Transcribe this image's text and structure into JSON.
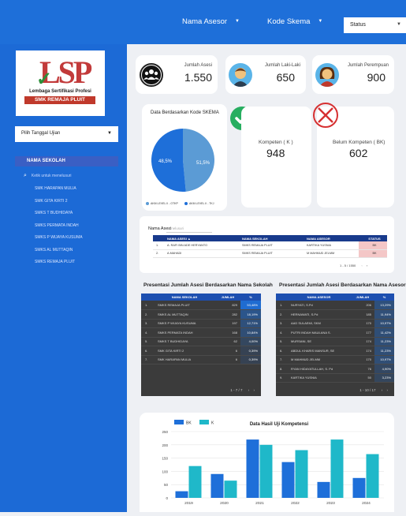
{
  "topbar": {
    "filter_asesor": "Nama Asesor",
    "filter_skema": "Kode Skema",
    "status_label": "Status"
  },
  "sidebar": {
    "logo_letters": "LSP",
    "logo_sub": "Lembaga Sertifikasi Profesi",
    "logo_band": "SMK REMAJA PLUIT",
    "date_placeholder": "Pilih Tanggal Ujian",
    "school_header": "NAMA SEKOLAH",
    "search_placeholder": "Ketik untuk menelusuri",
    "schools": [
      "SMK HARAPAN MULIA",
      "SMK GITA KIRTI 2",
      "SMKS T BUDHIDAYA",
      "SMKS PERMATA INDAH",
      "SMKS P WIJAYA KUSUMA",
      "SMKS AL MUTTAQIN",
      "SMKS REMAJA PLUIT"
    ]
  },
  "stats": {
    "total_label": "Jumlah Asesi",
    "total_value": "1.550",
    "male_label": "Jumlah Laki-Laki",
    "male_value": "650",
    "female_label": "Jumlah Perempuan",
    "female_value": "900"
  },
  "pie": {
    "title": "Data Berdasarkan Kode SKEMA",
    "slices": [
      {
        "label": "48,5%",
        "value": 48.5,
        "color": "#5b9bd5"
      },
      {
        "label": "51,5%",
        "value": 51.5,
        "color": "#1e6fd9"
      }
    ],
    "legend": [
      "AKM LEVEL II - OTKP",
      "AKM LEVEL II - TKJ"
    ]
  },
  "kompeten": {
    "label": "Kompeten ( K )",
    "value": "948"
  },
  "belum_kompeten": {
    "label": "Belum Kompeten ( BK)",
    "value": "602"
  },
  "asesi_table": {
    "search_label": "Nama Asesi",
    "search_placeholder": "Menelusuri",
    "headers": [
      "NAMA ASESI ▲",
      "NAMA SEKOLAH",
      "NAMA ASESOR",
      "STATUS"
    ],
    "rows": [
      {
        "no": "1.",
        "asesi": "A. RAFI BIN ADE HERYANTO",
        "sekolah": "SMKS REMAJA PLUIT",
        "asesor": "KARTIKA YUSNIA",
        "status": "BK"
      },
      {
        "no": "2.",
        "asesi": "A.MAHADI",
        "sekolah": "SMKS REMAJA PLUIT",
        "asesor": "M MAHMUD JELMM",
        "status": "BK"
      }
    ],
    "pager": "1 - 5 / 1550"
  },
  "school_table": {
    "title": "Presentasi Jumlah Asesi Berdasarkan Nama Sekolah",
    "headers": [
      "NAMA SEKOLAH",
      "JUMLAH",
      "%"
    ],
    "rows": [
      {
        "no": "1.",
        "name": "SMKS REMAJA PLUIT",
        "count": "829",
        "pct": "53,48%",
        "share": 0.5348
      },
      {
        "no": "2.",
        "name": "SMKS AL MUTTAQIN",
        "count": "282",
        "pct": "18,19%",
        "share": 0.1819
      },
      {
        "no": "3.",
        "name": "SMKS P WIJAYA KUSUMA",
        "count": "197",
        "pct": "12,71%",
        "share": 0.1271
      },
      {
        "no": "4.",
        "name": "SMKS PERMATA INDAH",
        "count": "168",
        "pct": "10,84%",
        "share": 0.1084
      },
      {
        "no": "5.",
        "name": "SMKS T BUDHIDAYA",
        "count": "62",
        "pct": "4,00%",
        "share": 0.04
      },
      {
        "no": "6.",
        "name": "SMK GITA KIRTI 2",
        "count": "6",
        "pct": "0,39%",
        "share": 0.0039
      },
      {
        "no": "7.",
        "name": "SMK HARAPAN MULIA",
        "count": "6",
        "pct": "0,39%",
        "share": 0.0039
      }
    ],
    "pager": "1 - 7 / 7"
  },
  "asesor_table": {
    "title": "Presentasi Jumlah Asesi Berdasarkan Nama Asesor",
    "headers": [
      "NAMA ASESOR",
      "JUMLAH",
      "%"
    ],
    "rows": [
      {
        "no": "1.",
        "name": "NURYATI, S.Pd",
        "count": "206",
        "pct": "13,29%",
        "share": 0.1329
      },
      {
        "no": "2.",
        "name": "HERNAWATI, S.Pd",
        "count": "185",
        "pct": "11,94%",
        "share": 0.1194
      },
      {
        "no": "3.",
        "name": "AAD SULAEMI, SKM",
        "count": "170",
        "pct": "10,97%",
        "share": 0.1097
      },
      {
        "no": "4.",
        "name": "PUTRI INDAH MAULANA S.",
        "count": "177",
        "pct": "11,42%",
        "share": 0.1142
      },
      {
        "no": "5.",
        "name": "MURSANI, SE",
        "count": "174",
        "pct": "11,23%",
        "share": 0.1123
      },
      {
        "no": "6.",
        "name": "ABDUL KHARIS MANSUR, SE",
        "count": "174",
        "pct": "11,23%",
        "share": 0.1123
      },
      {
        "no": "7.",
        "name": "M MAHMUD JELMM",
        "count": "170",
        "pct": "10,97%",
        "share": 0.1097
      },
      {
        "no": "8.",
        "name": "RYAN HIDAYATULLAH, S. Pd",
        "count": "76",
        "pct": "4,90%",
        "share": 0.049
      },
      {
        "no": "9.",
        "name": "KARTIKA YUSNIA",
        "count": "50",
        "pct": "3,23%",
        "share": 0.0323
      }
    ],
    "pager": "1 - 10 / 17"
  },
  "chart_data": {
    "type": "bar",
    "title": "Data Hasil Uji Kompetensi",
    "categories": [
      "2019",
      "2020",
      "2021",
      "2022",
      "2023",
      "2024"
    ],
    "series": [
      {
        "name": "BK",
        "values": [
          25,
          90,
          220,
          135,
          60,
          75
        ],
        "color": "#1e6fd9"
      },
      {
        "name": "K",
        "values": [
          120,
          65,
          200,
          180,
          220,
          165
        ],
        "color": "#1fb8c9"
      }
    ],
    "ylim": [
      0,
      250
    ],
    "yticks": [
      "0",
      "50",
      "100",
      "150",
      "200",
      "250"
    ],
    "grid": true,
    "legend": "top-left"
  },
  "colors": {
    "accent": "#1e6fd9",
    "sidebar": "#1c6ad6",
    "header_dark": "#183a8c",
    "bk_row": "#f4c7c7"
  }
}
